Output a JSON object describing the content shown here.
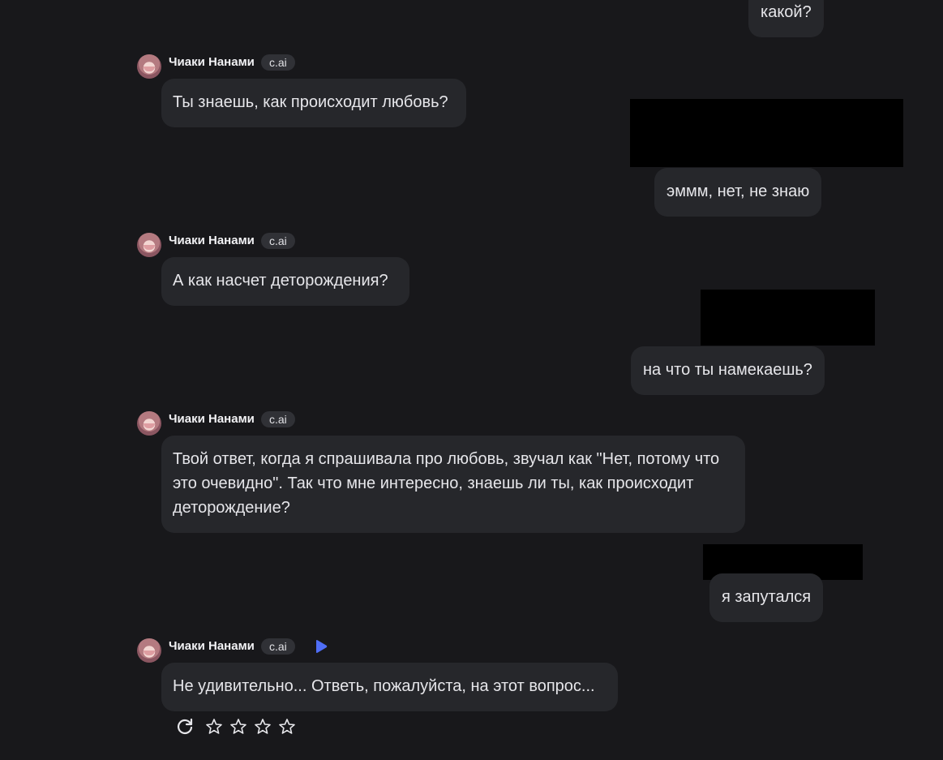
{
  "character": {
    "name": "Чиаки Нанами",
    "badge": "c.ai"
  },
  "messages": [
    {
      "role": "user",
      "text": "какой?"
    },
    {
      "role": "bot",
      "text": "Ты знаешь, как происходит любовь?"
    },
    {
      "role": "user",
      "text": "эммм, нет, не знаю"
    },
    {
      "role": "bot",
      "text": "А как насчет деторождения?"
    },
    {
      "role": "user",
      "text": "на что ты намекаешь?"
    },
    {
      "role": "bot",
      "text": "Твой ответ, когда я спрашивала про любовь, звучал как \"Нет, потому что это очевидно\". Так что мне интересно, знаешь ли ты, как происходит деторождение?"
    },
    {
      "role": "user",
      "text": "я запутался"
    },
    {
      "role": "bot",
      "text": "Не удивительно... Ответь, пожалуйста, на этот вопрос..."
    }
  ],
  "rating": {
    "stars": 4,
    "filled": 0
  },
  "icons": {
    "regenerate": "refresh-icon",
    "star": "star-icon",
    "play": "play-icon"
  },
  "colors": {
    "background": "#18181b",
    "bubble": "#26272b",
    "accent": "#4f6ef7"
  }
}
